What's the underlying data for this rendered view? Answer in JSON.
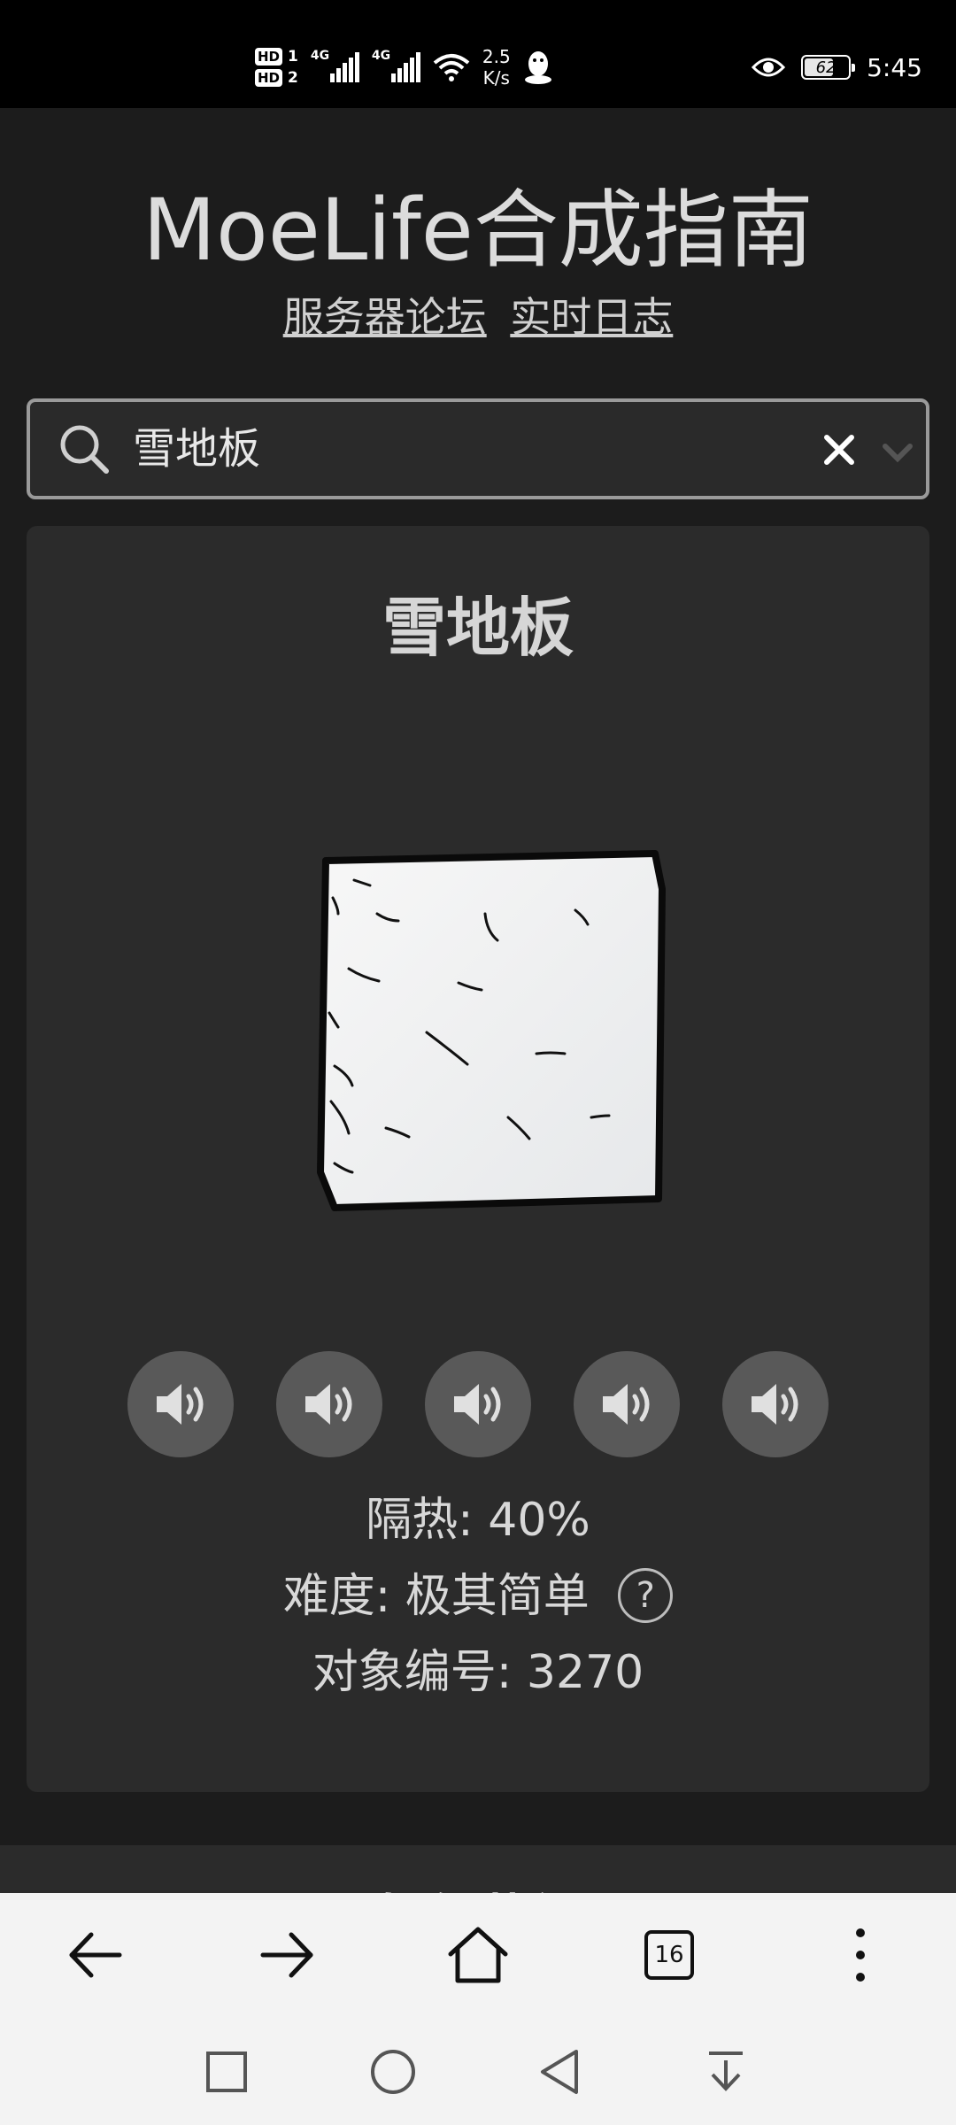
{
  "status_bar": {
    "hd1": "HD",
    "hd1_num": "1",
    "hd2": "HD",
    "hd2_num": "2",
    "net1": "4G",
    "net2": "4G",
    "speed_value": "2.5",
    "speed_unit": "K/s",
    "battery": "62",
    "time": "5:45"
  },
  "header": {
    "title": "MoeLife合成指南",
    "links": [
      "服务器论坛",
      "实时日志"
    ]
  },
  "search": {
    "value": "雪地板"
  },
  "item": {
    "name": "雪地板",
    "insulation_label": "隔热:",
    "insulation_value": "40%",
    "difficulty_label": "难度:",
    "difficulty_value": "极其简单",
    "help_symbol": "?",
    "id_label": "对象编号:",
    "id_value": "3270",
    "sound_buttons": 5
  },
  "next_section": {
    "title": "如何获得"
  },
  "browser": {
    "tab_count": "16"
  },
  "colors": {
    "background": "#1c1c1c",
    "card": "#2b2b2b",
    "sound_button": "#595959",
    "toolbar": "#f3f3f3"
  }
}
